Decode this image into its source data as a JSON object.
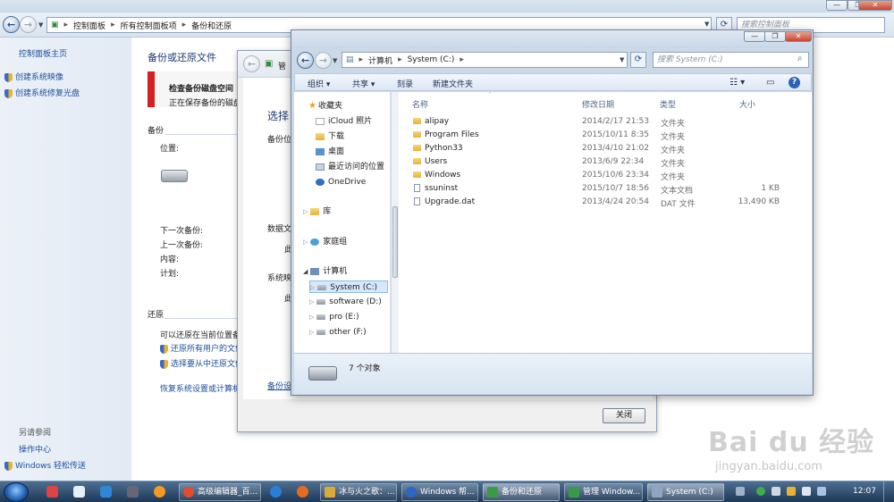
{
  "back_window": {
    "address": [
      "控制面板",
      "所有控制面板项",
      "备份和还原"
    ],
    "search_placeholder": "搜索控制面板",
    "sidebar": {
      "home": "控制面板主页",
      "items": [
        "创建系统映像",
        "创建系统修复光盘"
      ],
      "see_also": "另请参阅",
      "see_also_items": [
        "操作中心",
        "Windows 轻松传送"
      ]
    },
    "main": {
      "title": "备份或还原文件",
      "alert_title": "检查备份磁盘空间",
      "alert_text": "正在保存备份的磁盘",
      "backup_section": "备份",
      "location_label": "位置:",
      "next_backup": "下一次备份:",
      "last_backup": "上一次备份:",
      "content": "内容:",
      "schedule": "计划:",
      "restore_section": "还原",
      "restore_text": "可以还原在当前位置备",
      "restore_all_users": "还原所有用户的文件",
      "select_other": "选择要从中还原文件",
      "recover_link": "恢复系统设置或计算机"
    }
  },
  "dialog": {
    "title": "管",
    "heading": "选择",
    "labels": [
      "备份位",
      "数据文",
      "此",
      "系统映",
      "此"
    ],
    "link": "备份设",
    "close_button": "关闭"
  },
  "explorer": {
    "address": [
      "计算机",
      "System (C:)"
    ],
    "search_placeholder": "搜索 System (C:)",
    "commands": [
      "组织",
      "共享",
      "刻录",
      "新建文件夹"
    ],
    "nav": {
      "favorites": "收藏夹",
      "favorites_items": [
        "iCloud 照片",
        "下载",
        "桌面",
        "最近访问的位置",
        "OneDrive"
      ],
      "libraries": "库",
      "homegroup": "家庭组",
      "computer": "计算机",
      "drives": [
        "System (C:)",
        "software (D:)",
        "pro (E:)",
        "other (F:)"
      ]
    },
    "columns": [
      "名称",
      "修改日期",
      "类型",
      "大小"
    ],
    "files": [
      {
        "name": "alipay",
        "date": "2014/2/17 21:53",
        "type": "文件夹",
        "size": ""
      },
      {
        "name": "Program Files",
        "date": "2015/10/11 8:35",
        "type": "文件夹",
        "size": ""
      },
      {
        "name": "Python33",
        "date": "2013/4/10 21:02",
        "type": "文件夹",
        "size": ""
      },
      {
        "name": "Users",
        "date": "2013/6/9 22:34",
        "type": "文件夹",
        "size": ""
      },
      {
        "name": "Windows",
        "date": "2015/10/6 23:34",
        "type": "文件夹",
        "size": ""
      },
      {
        "name": "ssuninst",
        "date": "2015/10/7 18:56",
        "type": "文本文档",
        "size": "1 KB"
      },
      {
        "name": "Upgrade.dat",
        "date": "2013/4/24 20:54",
        "type": "DAT 文件",
        "size": "13,490 KB"
      }
    ],
    "status": "7 个对象"
  },
  "taskbar": {
    "tasks": [
      "高级编辑器_百...",
      "冰与火之歌：...",
      "Windows 帮...",
      "备份和还原",
      "管理 Window...",
      "System (C:)"
    ],
    "clock": "12:07"
  },
  "watermark": {
    "text": "Bai du 经验",
    "url": "jingyan.baidu.com"
  },
  "colors": {
    "link": "#1b4f9c",
    "selection": "#d6e8fb",
    "alert_red": "#d42020",
    "taskbar": "#2b4a6e"
  }
}
